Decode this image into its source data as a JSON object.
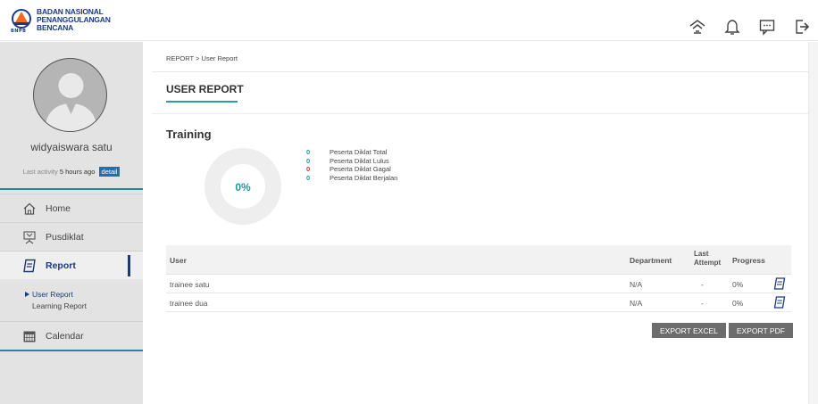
{
  "brand": {
    "line1": "BADAN NASIONAL",
    "line2": "PENANGGULANGAN BENCANA",
    "abbr": "BNPB"
  },
  "topbar": {
    "icons": [
      "home-icon",
      "bell-icon",
      "chat-icon",
      "logout-icon"
    ]
  },
  "sidebar": {
    "username": "widyaiswara satu",
    "activity_prefix": "Last activity",
    "activity_time": "5 hours ago",
    "detail_label": "detail",
    "items": [
      {
        "label": "Home",
        "icon": "home-icon"
      },
      {
        "label": "Pusdiklat",
        "icon": "pusdiklat-icon"
      },
      {
        "label": "Report",
        "icon": "report-icon"
      },
      {
        "label": "Calendar",
        "icon": "calendar-icon"
      }
    ],
    "subitems": [
      {
        "label": "User Report"
      },
      {
        "label": "Learning Report"
      }
    ]
  },
  "main": {
    "breadcrumb": "REPORT  >  User Report",
    "title": "USER REPORT",
    "section": "Training",
    "progress_label": "0%",
    "progress_value": 0,
    "stats": [
      {
        "value": "0",
        "label": "Peserta Diklat Total",
        "color": "#1f9a9a"
      },
      {
        "value": "0",
        "label": "Peserta Diklat Lulus",
        "color": "#1f9a9a"
      },
      {
        "value": "0",
        "label": "Peserta Diklat Gagal",
        "color": "#d0312d"
      },
      {
        "value": "0",
        "label": "Peserta Diklat Berjalan",
        "color": "#1f9a9a"
      }
    ],
    "table": {
      "headers": {
        "user": "User",
        "department": "Department",
        "last_attempt_1": "Last",
        "last_attempt_2": "Attempt",
        "progress": "Progress"
      },
      "rows": [
        {
          "user": "trainee satu",
          "department": "N/A",
          "last_attempt": "-",
          "progress": "0%"
        },
        {
          "user": "trainee dua",
          "department": "N/A",
          "last_attempt": "-",
          "progress": "0%"
        }
      ]
    },
    "buttons": {
      "export_excel": "EXPORT EXCEL",
      "export_pdf": "EXPORT PDF"
    }
  },
  "colors": {
    "accent": "#1f9a9a",
    "nav_active": "#1a3a7a",
    "detail": "#1f6fb5",
    "button": "#6c6c6c"
  }
}
